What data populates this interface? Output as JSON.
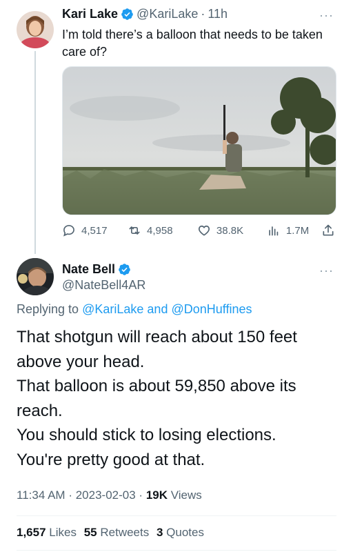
{
  "tweet1": {
    "name": "Kari Lake",
    "handle": "@KariLake",
    "dot": "·",
    "time": "11h",
    "more": "···",
    "text": "I’m told there’s a balloon that needs to be taken care of?",
    "actions": {
      "replies": "4,517",
      "retweets": "4,958",
      "likes": "38.8K",
      "views": "1.7M"
    }
  },
  "tweet2": {
    "name": "Nate Bell",
    "handle": "@NateBell4AR",
    "more": "···",
    "replying_prefix": "Replying to",
    "replying_to_1": "@KariLake",
    "replying_and": "and",
    "replying_to_2": "@DonHuffines",
    "lines": [
      "That shotgun will reach about 150 feet",
      "above your head.",
      "That balloon is about 59,850 above its",
      "reach.",
      "You should stick to losing elections.",
      "You're pretty good at that."
    ],
    "time": "11:34 AM",
    "date": "2023-02-03",
    "sep": "·",
    "views_count": "19K",
    "views_label": "Views",
    "stats": {
      "likes_count": "1,657",
      "likes_label": "Likes",
      "retweets_count": "55",
      "retweets_label": "Retweets",
      "quotes_count": "3",
      "quotes_label": "Quotes"
    }
  },
  "colors": {
    "text": "#0f1419",
    "secondary": "#536471",
    "link": "#1d9bf0",
    "verified": "#1d9bf0",
    "divider": "#eff3f4"
  },
  "icons": [
    "verified-badge-icon",
    "more-icon",
    "reply-icon",
    "retweet-icon",
    "like-icon",
    "views-icon",
    "share-icon"
  ]
}
